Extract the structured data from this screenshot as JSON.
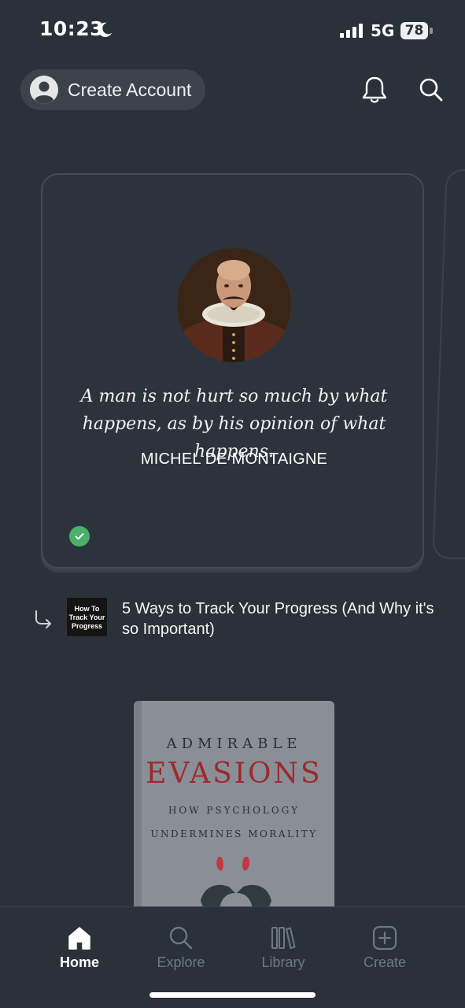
{
  "status_bar": {
    "time": "10:23",
    "network": "5G",
    "battery": "78"
  },
  "header": {
    "create_account_label": "Create Account"
  },
  "quote_card": {
    "quote": "A man is not hurt so much by what happens, as by his opinion of what happens.",
    "author": "MICHEL DE MONTAIGNE",
    "completed": true
  },
  "linked_article": {
    "thumbnail_text": "How To Track Your Progress",
    "title": "5 Ways to Track Your Progress (And Why it's so Important)"
  },
  "book": {
    "line1": "ADMIRABLE",
    "line2": "EVASIONS",
    "line3": "HOW PSYCHOLOGY",
    "line4": "UNDERMINES MORALITY"
  },
  "bottom_nav": {
    "items": [
      {
        "label": "Home",
        "icon": "home-icon",
        "active": true
      },
      {
        "label": "Explore",
        "icon": "search-icon",
        "active": false
      },
      {
        "label": "Library",
        "icon": "library-icon",
        "active": false
      },
      {
        "label": "Create",
        "icon": "plus-square-icon",
        "active": false
      }
    ]
  },
  "colors": {
    "background": "#2b313a",
    "check_green": "#4caf6a",
    "inactive_nav": "#6f7781"
  }
}
